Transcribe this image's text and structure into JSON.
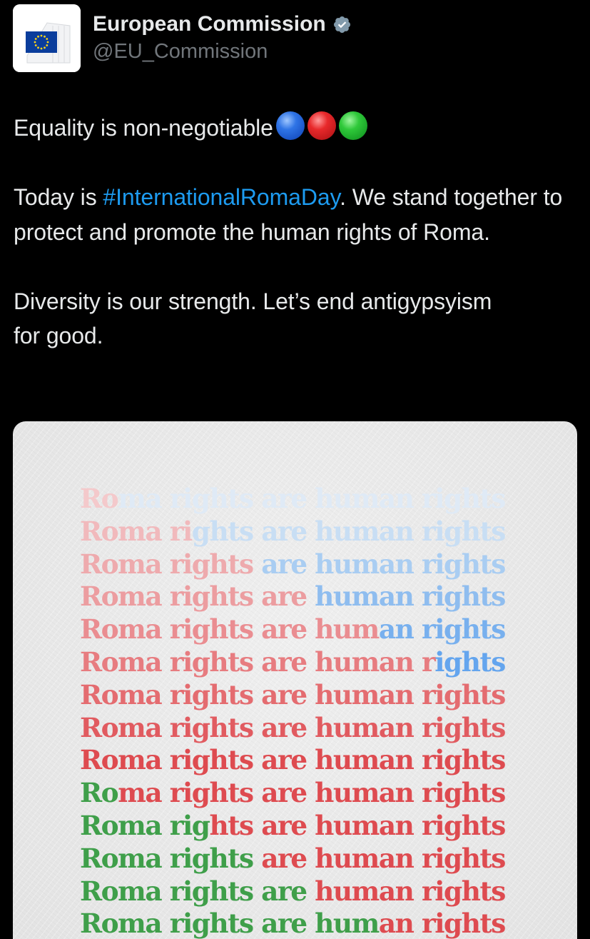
{
  "header": {
    "display_name": "European Commission",
    "handle": "@EU_Commission",
    "avatar_icon": "eu-flag-icon",
    "verified_icon": "verified-badge-icon"
  },
  "tweet": {
    "line1": "Equality is non-negotiable",
    "emojis": [
      "blue-circle-icon",
      "red-circle-icon",
      "green-circle-icon"
    ],
    "para2_prefix": "Today is ",
    "hashtag": "#InternationalRomaDay",
    "para2_suffix": ". We stand together to protect and promote the human rights of Roma.",
    "para3": "Diversity is our strength. Let’s end antigypsyism for good."
  },
  "colors": {
    "background": "#000000",
    "text": "#e7e9ea",
    "handle": "#71767b",
    "hashtag": "#1d9bf0",
    "poster_red": "#e0474c",
    "poster_blue": "#5aa6f0",
    "poster_green": "#3f9f4a"
  },
  "poster": {
    "phrase": "Roma rights are human rights",
    "lines": [
      {
        "segments": [
          {
            "text": "Ro",
            "color": "#f4c9cb"
          },
          {
            "text": "ma rights are human rights",
            "color": "#dfeaf6"
          }
        ]
      },
      {
        "segments": [
          {
            "text": "Roma ri",
            "color": "#f1b9bc"
          },
          {
            "text": "ghts are human rights",
            "color": "#c8def4"
          }
        ]
      },
      {
        "segments": [
          {
            "text": "Roma rights ",
            "color": "#eeaaad"
          },
          {
            "text": "are human rights",
            "color": "#a9cdf2"
          }
        ]
      },
      {
        "segments": [
          {
            "text": "Roma rights are ",
            "color": "#ec9da0"
          },
          {
            "text": "human rights",
            "color": "#8fbdef"
          }
        ]
      },
      {
        "segments": [
          {
            "text": "Roma rights are hum",
            "color": "#ea8d91"
          },
          {
            "text": "an rights",
            "color": "#78b0ee"
          }
        ]
      },
      {
        "segments": [
          {
            "text": "Roma rights are human r",
            "color": "#e77c80"
          },
          {
            "text": "ights",
            "color": "#64a5ee"
          }
        ]
      },
      {
        "segments": [
          {
            "text": "Roma rights are human rights",
            "color": "#e46c70"
          }
        ]
      },
      {
        "segments": [
          {
            "text": "Roma rights are human rights",
            "color": "#e15b60"
          }
        ]
      },
      {
        "segments": [
          {
            "text": "Roma rights are human rights",
            "color": "#de4b50"
          }
        ]
      },
      {
        "segments": [
          {
            "text": "Ro",
            "color": "#3f9f4a"
          },
          {
            "text": "ma rights are human rights",
            "color": "#de4b50"
          }
        ]
      },
      {
        "segments": [
          {
            "text": "Roma rig",
            "color": "#3f9f4a"
          },
          {
            "text": "hts are human rights",
            "color": "#de4b50"
          }
        ]
      },
      {
        "segments": [
          {
            "text": "Roma rights ",
            "color": "#3f9f4a"
          },
          {
            "text": "are human rights",
            "color": "#de4b50"
          }
        ]
      },
      {
        "segments": [
          {
            "text": "Roma rights are ",
            "color": "#3f9f4a"
          },
          {
            "text": "human rights",
            "color": "#de4b50"
          }
        ]
      },
      {
        "segments": [
          {
            "text": "Roma rights are hum",
            "color": "#3f9f4a"
          },
          {
            "text": "an rights",
            "color": "#de4b50"
          }
        ]
      }
    ]
  }
}
